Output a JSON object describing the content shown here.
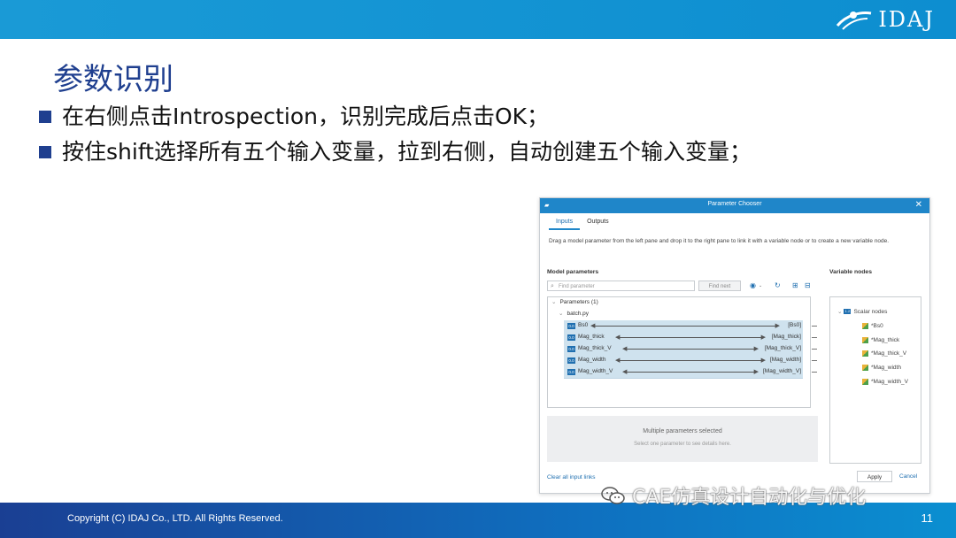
{
  "slide": {
    "title": "参数识别",
    "bullets": [
      "在右侧点击Introspection，识别完成后点击OK；",
      "按住shift选择所有五个输入变量，拉到右侧，自动创建五个输入变量；"
    ],
    "logo_text": "IDAJ",
    "copyright": "Copyright (C)  IDAJ Co., LTD. All Rights Reserved.",
    "page_number": "11",
    "watermark": "CAE仿真设计自动化与优化"
  },
  "dialog": {
    "title": "Parameter Chooser",
    "tabs": [
      {
        "label": "Inputs",
        "active": true
      },
      {
        "label": "Outputs",
        "active": false
      }
    ],
    "description": "Drag a model parameter from the left pane and drop it to the right pane to link it with a variable node or to create a new variable node.",
    "model_parameters_label": "Model parameters",
    "variable_nodes_label": "Variable nodes",
    "search_placeholder": "Find parameter",
    "find_next_label": "Find next",
    "tree": {
      "root": "Parameters (1)",
      "file": "batch.py",
      "links": [
        {
          "name": "Bs0",
          "target": "[Bs0]"
        },
        {
          "name": "Mag_thick",
          "target": "[Mag_thick]"
        },
        {
          "name": "Mag_thick_V",
          "target": "[Mag_thick_V]"
        },
        {
          "name": "Mag_width",
          "target": "[Mag_width]"
        },
        {
          "name": "Mag_width_V",
          "target": "[Mag_width_V]"
        }
      ]
    },
    "multi_selected_title": "Multiple parameters selected",
    "multi_selected_hint": "Select one parameter to see details here.",
    "scalar_nodes_label": "Scalar nodes",
    "scalar_nodes": [
      "*Bs0",
      "*Mag_thick",
      "*Mag_thick_V",
      "*Mag_width",
      "*Mag_width_V"
    ],
    "clear_links_label": "Clear all input links",
    "apply_label": "Apply",
    "cancel_label": "Cancel",
    "accent_color": "#1f86c9"
  }
}
